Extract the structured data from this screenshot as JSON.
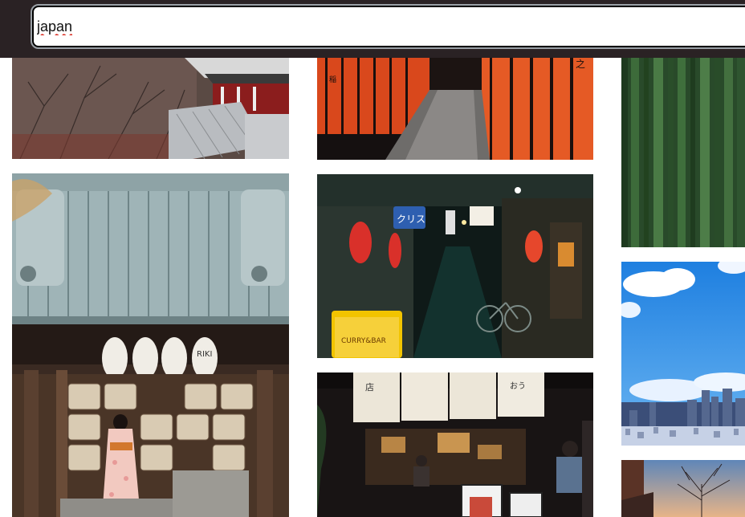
{
  "search": {
    "value": "japan",
    "icon": "search-input"
  },
  "photos": [
    {
      "name": "photo-pagoda-roof-winter",
      "alt": "pagoda roof"
    },
    {
      "name": "photo-torii-gates-path",
      "alt": "torii gates"
    },
    {
      "name": "photo-bamboo-forest",
      "alt": "bamboo forest"
    },
    {
      "name": "photo-shrine-sake-barrels-kimono",
      "alt": "shrine"
    },
    {
      "name": "photo-alley-night-lanterns",
      "alt": "alley"
    },
    {
      "name": "photo-tokyo-skyline-sky",
      "alt": "skyline"
    },
    {
      "name": "photo-restaurant-noren",
      "alt": "restaurant"
    },
    {
      "name": "photo-bare-tree-sunset",
      "alt": "tree"
    }
  ],
  "colors": {
    "topbar": "#2a2224",
    "torii": "#d9481c",
    "bamboo": "#2f5b2f",
    "sky": "#2f8fe6"
  }
}
